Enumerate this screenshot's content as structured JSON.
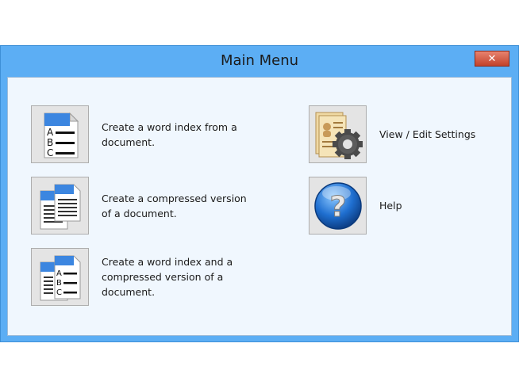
{
  "window": {
    "title": "Main Menu",
    "close_label": "✕"
  },
  "menu": {
    "word_index": {
      "label": "Create a word index from a\ndocument.",
      "icon": "word-index-icon"
    },
    "compress": {
      "label": "Create a compressed version\nof a document.",
      "icon": "compress-document-icon"
    },
    "index_and_compress": {
      "label": "Create a word index and a\ncompressed version of a\ndocument.",
      "icon": "index-and-compress-icon"
    },
    "settings": {
      "label": "View / Edit Settings",
      "icon": "settings-gear-icon"
    },
    "help": {
      "label": "Help",
      "icon": "help-question-icon"
    }
  },
  "colors": {
    "title_bar": "#5caef4",
    "client_bg": "#f0f7fe",
    "close_button": "#c2422b",
    "icon_button_bg": "#e4e4e4"
  }
}
